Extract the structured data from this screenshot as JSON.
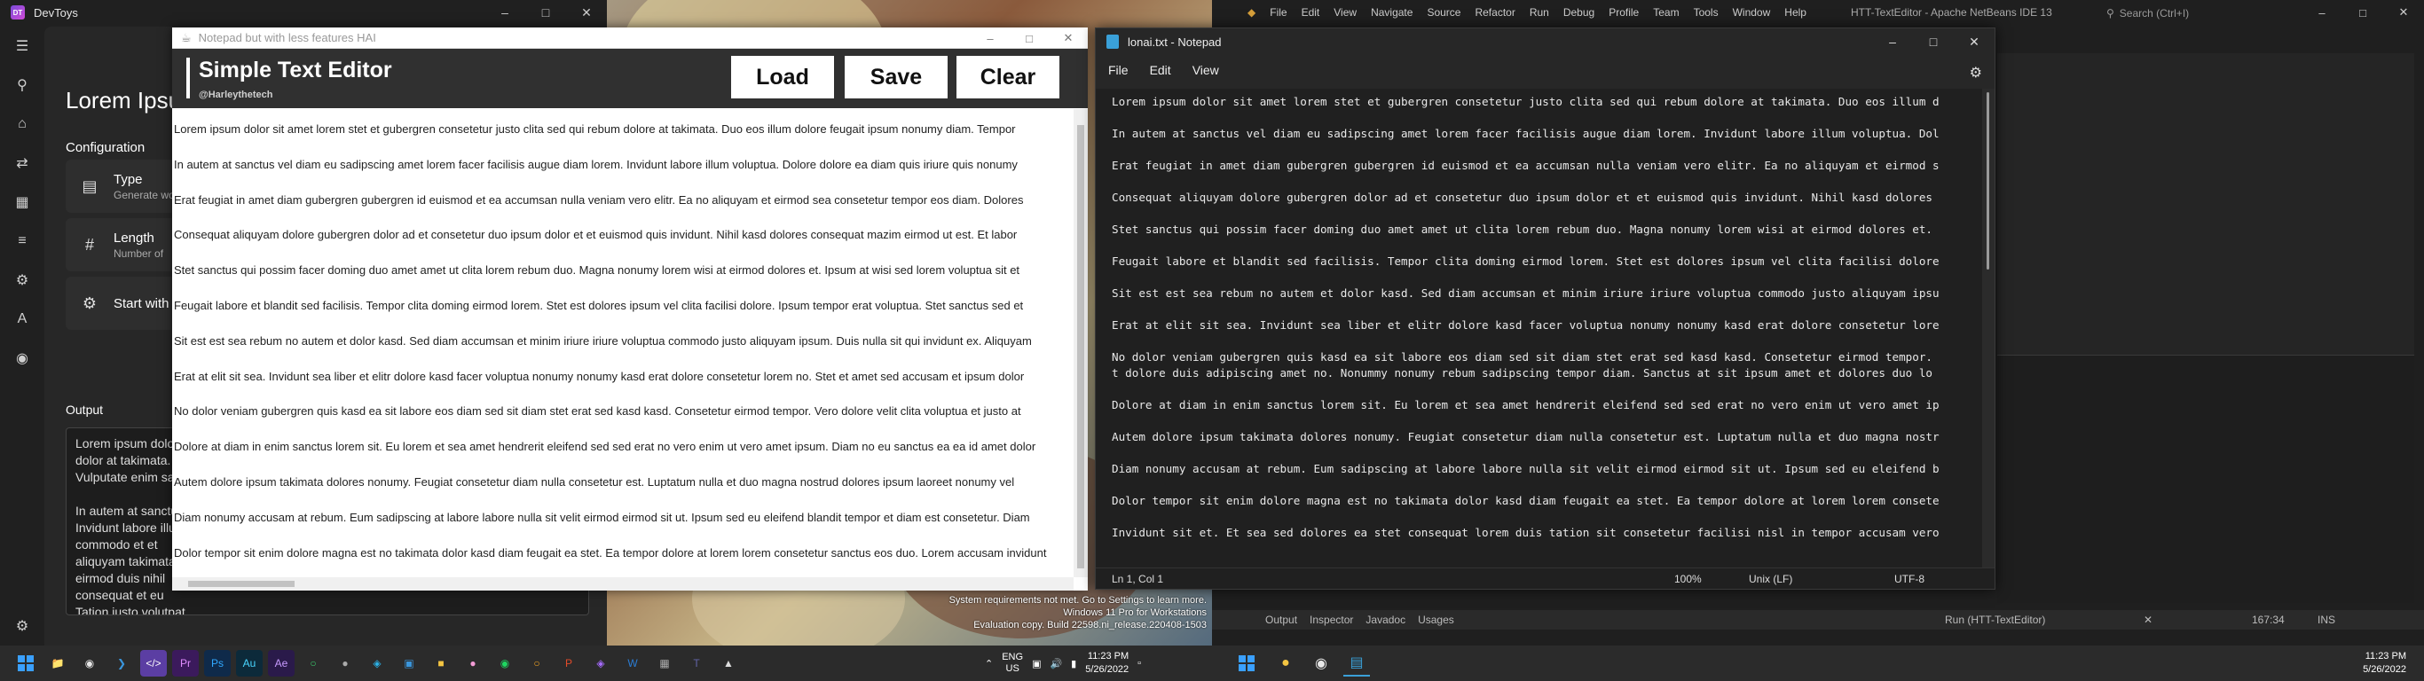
{
  "devtoys": {
    "app_title": "DevToys",
    "page_title": "Lorem Ipsum",
    "configuration_label": "Configuration",
    "type_label": "Type",
    "type_desc": "Generate words",
    "length_label": "Length",
    "length_desc": "Number of",
    "start_label": "Start with",
    "output_label": "Output",
    "output_text": "Lorem ipsum dolor sit amet\ndolor at takimata.\nVulputate enim sanctus\n\nIn autem at sanctus vel diam\nInvidunt labore illum\ncommodo et et\naliquyam takimata\neirmod duis nihil\nconsequat et eu\nTation justo volutpat"
  },
  "simple_editor": {
    "window_title": "Notepad but with less features HAI",
    "app_name": "Simple Text Editor",
    "author": "@Harleythetech",
    "load_label": "Load",
    "save_label": "Save",
    "clear_label": "Clear",
    "lines": [
      "Lorem ipsum dolor sit amet lorem stet et gubergren consetetur justo clita sed qui rebum dolore at takimata. Duo eos illum dolore feugait ipsum nonumy diam. Tempor",
      "In autem at sanctus vel diam eu sadipscing amet lorem facer facilisis augue diam lorem. Invidunt labore illum voluptua. Dolore dolore ea diam quis iriure quis nonumy",
      "Erat feugiat in amet diam gubergren gubergren id euismod et ea accumsan nulla veniam vero elitr. Ea no aliquyam et eirmod sea consetetur tempor eos diam. Dolores",
      "Consequat aliquyam dolore gubergren dolor ad et consetetur duo ipsum dolor et et euismod quis invidunt. Nihil kasd dolores consequat mazim eirmod ut est. Et labor",
      "Stet sanctus qui possim facer doming duo amet amet ut clita lorem rebum duo. Magna nonumy lorem wisi at eirmod dolores et. Ipsum at wisi sed lorem voluptua sit et",
      "Feugait labore et blandit sed facilisis. Tempor clita doming eirmod lorem. Stet est dolores ipsum vel clita facilisi dolore. Ipsum tempor erat voluptua. Stet sanctus sed et",
      "Sit est est sea rebum no autem et dolor kasd. Sed diam accumsan et minim iriure iriure voluptua commodo justo aliquyam ipsum. Duis nulla sit qui invidunt ex. Aliquyam",
      "Erat at elit sit sea. Invidunt sea liber et elitr dolore kasd facer voluptua nonumy nonumy kasd erat dolore consetetur lorem no. Stet et amet sed accusam et ipsum dolor",
      "No dolor veniam gubergren quis kasd ea sit labore eos diam sed sit diam stet erat sed kasd kasd. Consetetur eirmod tempor. Vero dolore velit clita voluptua et justo at",
      "Dolore at diam in enim sanctus lorem sit. Eu lorem et sea amet hendrerit eleifend sed sed erat no vero enim ut vero amet ipsum. Diam no eu sanctus ea ea id amet dolor",
      "Autem dolore ipsum takimata dolores nonumy. Feugiat consetetur diam nulla consetetur est. Luptatum nulla et duo magna nostrud dolores ipsum laoreet nonumy vel",
      "Diam nonumy accusam at rebum. Eum sadipscing at labore labore nulla sit velit eirmod eirmod sit ut. Ipsum sed eu eleifend blandit tempor et diam est consetetur. Diam",
      "Dolor tempor sit enim dolore magna est no takimata dolor kasd diam feugait ea stet. Ea tempor dolore at lorem lorem consetetur sanctus eos duo. Lorem accusam invidunt"
    ]
  },
  "watermark": {
    "line1": "System requirements not met. Go to Settings to learn more.",
    "line2": "Windows 11 Pro for Workstations",
    "line3": "Evaluation copy. Build 22598.ni_release.220408-1503"
  },
  "taskbar1": {
    "lang1": "ENG",
    "lang2": "US",
    "time": "11:23 PM",
    "date": "5/26/2022"
  },
  "netbeans": {
    "menu": [
      "File",
      "Edit",
      "View",
      "Navigate",
      "Source",
      "Refactor",
      "Run",
      "Debug",
      "Profile",
      "Team",
      "Tools",
      "Window",
      "Help"
    ],
    "title": "HTT-TextEditor - Apache NetBeans IDE 13",
    "search_placeholder": "Search (Ctrl+I)",
    "output_tab": "Output",
    "inspector_tab": "Inspector",
    "javadoc_tab": "Javadoc",
    "usages_tab": "Usages",
    "run_status": "Run (HTT-TextEditor)",
    "position": "167:34",
    "ins": "INS"
  },
  "notepad": {
    "window_title": "lonai.txt - Notepad",
    "menu_file": "File",
    "menu_edit": "Edit",
    "menu_view": "View",
    "status_position": "Ln 1, Col 1",
    "status_zoom": "100%",
    "status_eol": "Unix (LF)",
    "status_encoding": "UTF-8",
    "text": "Lorem ipsum dolor sit amet lorem stet et gubergren consetetur justo clita sed qui rebum dolore at takimata. Duo eos illum d\n\nIn autem at sanctus vel diam eu sadipscing amet lorem facer facilisis augue diam lorem. Invidunt labore illum voluptua. Dol\n\nErat feugiat in amet diam gubergren gubergren id euismod et ea accumsan nulla veniam vero elitr. Ea no aliquyam et eirmod s\n\nConsequat aliquyam dolore gubergren dolor ad et consetetur duo ipsum dolor et et euismod quis invidunt. Nihil kasd dolores\n\nStet sanctus qui possim facer doming duo amet amet ut clita lorem rebum duo. Magna nonumy lorem wisi at eirmod dolores et.\n\nFeugait labore et blandit sed facilisis. Tempor clita doming eirmod lorem. Stet est dolores ipsum vel clita facilisi dolore\n\nSit est est sea rebum no autem et dolor kasd. Sed diam accumsan et minim iriure iriure voluptua commodo justo aliquyam ipsu\n\nErat at elit sit sea. Invidunt sea liber et elitr dolore kasd facer voluptua nonumy nonumy kasd erat dolore consetetur lore\n\nNo dolor veniam gubergren quis kasd ea sit labore eos diam sed sit diam stet erat sed kasd kasd. Consetetur eirmod tempor.\nt dolore duis adipiscing amet no. Nonummy nonumy rebum sadipscing tempor diam. Sanctus at sit ipsum amet et dolores duo lo\n\nDolore at diam in enim sanctus lorem sit. Eu lorem et sea amet hendrerit eleifend sed sed erat no vero enim ut vero amet ip\n\nAutem dolore ipsum takimata dolores nonumy. Feugiat consetetur diam nulla consetetur est. Luptatum nulla et duo magna nostr\n\nDiam nonumy accusam at rebum. Eum sadipscing at labore labore nulla sit velit eirmod eirmod sit ut. Ipsum sed eu eleifend b\n\nDolor tempor sit enim dolore magna est no takimata dolor kasd diam feugait ea stet. Ea tempor dolore at lorem lorem consete\n\nInvidunt sit et. Et sea sed dolores ea stet consequat lorem duis tation sit consetetur facilisi nisl in tempor accusam vero"
  },
  "taskbar2": {
    "time": "11:23 PM",
    "date": "5/26/2022"
  }
}
